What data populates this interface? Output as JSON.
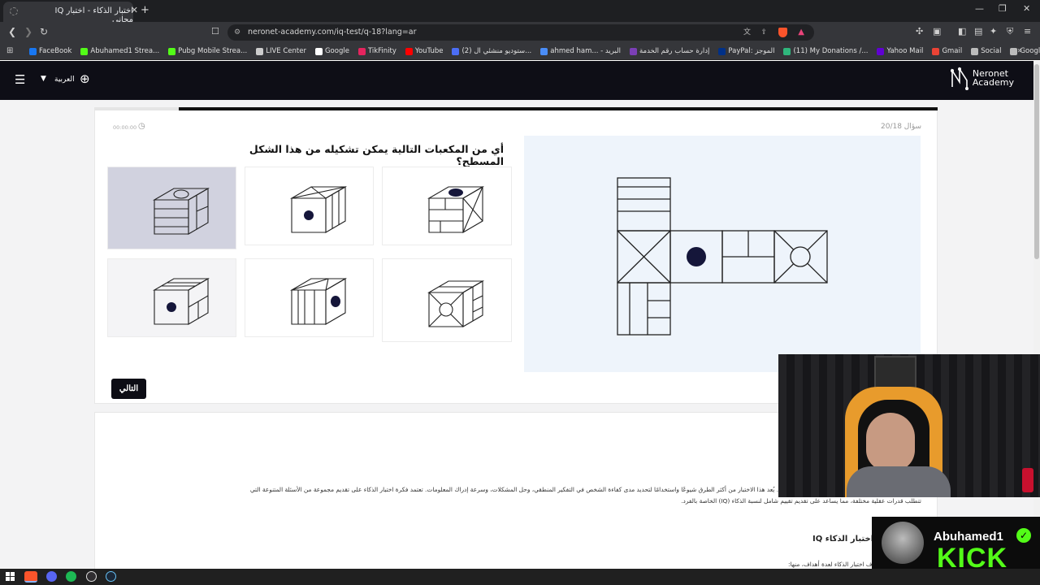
{
  "browser": {
    "tab_title": "اختبار الذكاء - اختبار IQ مجاني",
    "new_tab": "+",
    "url": "neronet-academy.com/iq-test/q-18?lang=ar",
    "window_buttons": [
      "—",
      "❐",
      "✕"
    ]
  },
  "bookmarks": [
    {
      "label": "FaceBook",
      "color": "#1877f2"
    },
    {
      "label": "Abuhamed1 Strea...",
      "color": "#53fc18"
    },
    {
      "label": "Pubg Mobile Strea...",
      "color": "#53fc18"
    },
    {
      "label": "LIVE Center",
      "color": "#cccccc"
    },
    {
      "label": "Google",
      "color": "#ffffff"
    },
    {
      "label": "TikFinity",
      "color": "#e5245e"
    },
    {
      "label": "YouTube",
      "color": "#ff0000"
    },
    {
      "label": "(2) ستوديو منشئي ال...",
      "color": "#4c6ef5"
    },
    {
      "label": "ahmed ham... - البريد",
      "color": "#4a8df8"
    },
    {
      "label": "إدارة حساب رقم الخدمة",
      "color": "#7b3fb6"
    },
    {
      "label": "PayPal: الموجز",
      "color": "#003087"
    },
    {
      "label": "(11) My Donations /...",
      "color": "#2fb67c"
    },
    {
      "label": "Yahoo Mail",
      "color": "#6001d2"
    },
    {
      "label": "Gmail",
      "color": "#ea4335"
    },
    {
      "label": "Social",
      "color": "#bbbbbb"
    },
    {
      "label": "Google",
      "color": "#bbbbbb"
    }
  ],
  "site": {
    "language": "العربية",
    "logo_line1": "Neronet",
    "logo_line2": "Academy"
  },
  "quiz": {
    "timer": "00:00:00",
    "counter": "سؤال 20/18",
    "question": "أي من المكعبات التالية يمكن تشكيله من هذا الشكل المسطح؟",
    "next_label": "التالي",
    "progress": 0.9,
    "selected_option": 3,
    "hovered_option": 6
  },
  "article": {
    "line1": "هو اختبار لقياس القدرات العقلية ومعدل الذكاء العام للفرد. يُعد هذا الاختبار من أكثر الطرق شيوعًا واستخدامًا لتحديد مدى كفاءة الشخص في التفكير المنطقي، وحل المشكلات، وسرعة إدراك المعلومات. تعتمد فكرة اختبار الذكاء على تقديم مجموعة من الأسئلة المتنوعة التي",
    "line2": "تتطلب قدرات عقلية مختلفة، مما يساعد على تقديم تقييم شامل لنسبة الذكاء (IQ) الخاصة بالفرد.",
    "heading": "أهداف اختبار الذكاء IQ",
    "line3": "يهدف اختبار الذكاء لعدة أهداف، منها:"
  },
  "stream": {
    "name": "Abuhamed1",
    "platform": "KICK",
    "accent": "#53fc18"
  }
}
